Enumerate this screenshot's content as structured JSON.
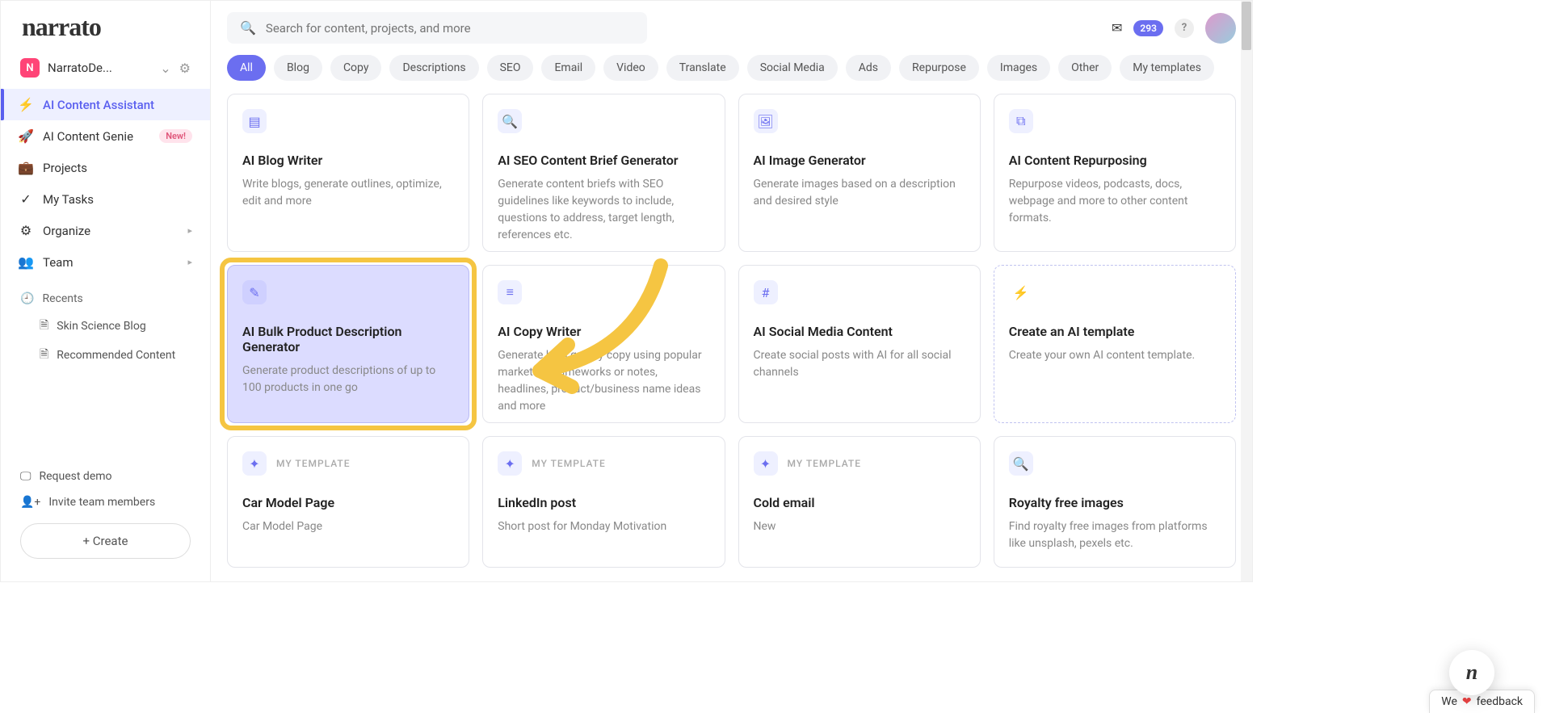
{
  "brand": "narrato",
  "workspace": {
    "badge": "N",
    "name": "NarratoDe..."
  },
  "nav": {
    "ai_assistant": "AI Content Assistant",
    "ai_genie": "AI Content Genie",
    "new_badge": "New!",
    "projects": "Projects",
    "my_tasks": "My Tasks",
    "organize": "Organize",
    "team": "Team"
  },
  "recents": {
    "header": "Recents",
    "items": [
      "Skin Science Blog",
      "Recommended Content"
    ]
  },
  "sidebar_bottom": {
    "request_demo": "Request demo",
    "invite": "Invite team members",
    "create": "+ Create"
  },
  "search": {
    "placeholder": "Search for content, projects, and more"
  },
  "topbar": {
    "count": "293"
  },
  "filters": [
    "All",
    "Blog",
    "Copy",
    "Descriptions",
    "SEO",
    "Email",
    "Video",
    "Translate",
    "Social Media",
    "Ads",
    "Repurpose",
    "Images",
    "Other",
    "My templates"
  ],
  "cards": [
    {
      "title": "AI Blog Writer",
      "desc": "Write blogs, generate outlines, optimize, edit and more"
    },
    {
      "title": "AI SEO Content Brief Generator",
      "desc": "Generate content briefs with SEO guidelines like keywords to include, questions to address, target length, references etc."
    },
    {
      "title": "AI Image Generator",
      "desc": "Generate images based on a description and desired style"
    },
    {
      "title": "AI Content Repurposing",
      "desc": "Repurpose videos, podcasts, docs, webpage and more to other content formats."
    },
    {
      "title": "AI Bulk Product Description Generator",
      "desc": "Generate product descriptions of up to 100 products in one go"
    },
    {
      "title": "AI Copy Writer",
      "desc": "Generate high quality copy using popular marketing frameworks or notes, headlines, product/business name ideas and more"
    },
    {
      "title": "AI Social Media Content",
      "desc": "Create social posts with AI for all social channels"
    },
    {
      "title": "Create an AI template",
      "desc": "Create your own AI content template."
    }
  ],
  "my_template_label": "MY TEMPLATE",
  "mt_cards": [
    {
      "title": "Car Model Page",
      "desc": "Car Model Page"
    },
    {
      "title": "LinkedIn post",
      "desc": "Short post for Monday Motivation"
    },
    {
      "title": "Cold email",
      "desc": "New"
    },
    {
      "title": "Royalty free images",
      "desc": "Find royalty free images from platforms like unsplash, pexels etc."
    }
  ],
  "feedback": {
    "pre": "We",
    "post": "feedback"
  },
  "fab": "n"
}
